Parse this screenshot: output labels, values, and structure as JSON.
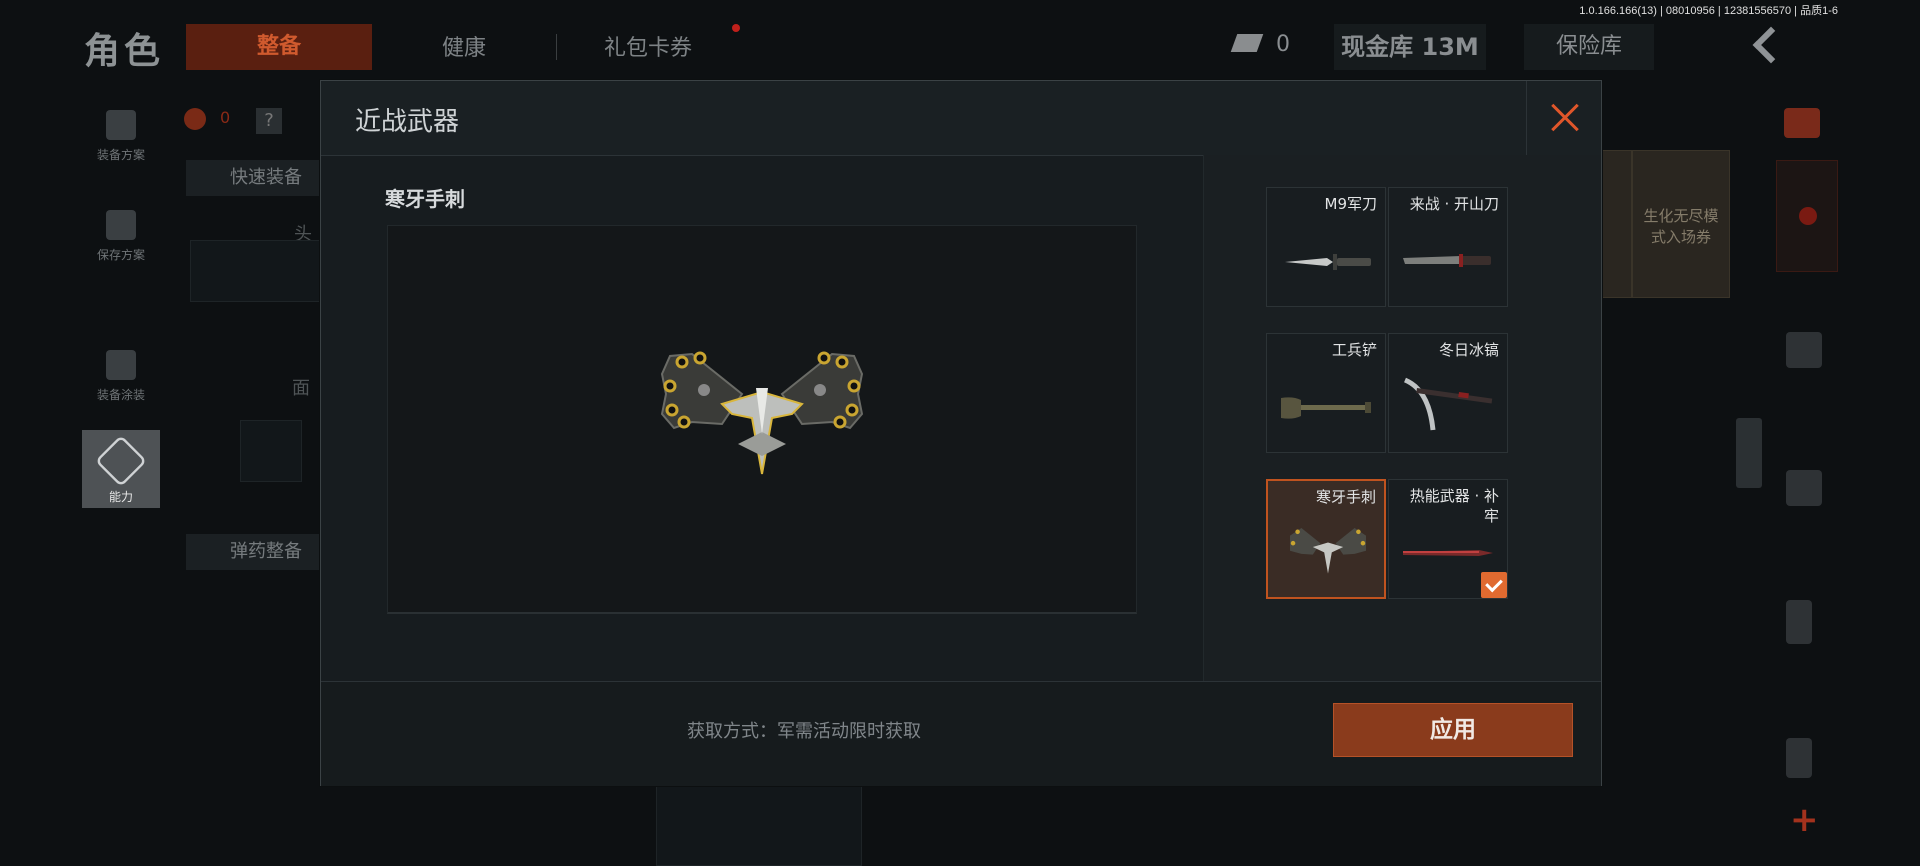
{
  "version_text": "1.0.166.166(13) | 08010956 | 12381556570 | 品质1-6",
  "background": {
    "title": "角色",
    "tabs": [
      "整备",
      "健康",
      "礼包卡券"
    ],
    "money_count": "0",
    "vault": "现金库 13M",
    "safe": "保险库",
    "side_buttons": [
      "装备方案",
      "保存方案",
      "装备涂装",
      "能力"
    ],
    "quick_equip": "快速装备",
    "ammo_equip": "弹药整备",
    "slot_head": "头",
    "slot_face": "面",
    "cards": [
      "生化无尽模式入场券"
    ],
    "red_count": "0"
  },
  "modal": {
    "title": "近战武器",
    "selected_item_name": "寒牙手刺",
    "source_text": "获取方式：军需活动限时获取",
    "apply_label": "应用",
    "items": [
      {
        "label": "M9军刀",
        "selected": false,
        "equipped": false,
        "icon": "knife-icon"
      },
      {
        "label": "来战 · 开山刀",
        "selected": false,
        "equipped": false,
        "icon": "machete-icon"
      },
      {
        "label": "工兵铲",
        "selected": false,
        "equipped": false,
        "icon": "shovel-icon"
      },
      {
        "label": "冬日冰镐",
        "selected": false,
        "equipped": false,
        "icon": "pickaxe-icon"
      },
      {
        "label": "寒牙手刺",
        "selected": true,
        "equipped": false,
        "icon": "claw-icon"
      },
      {
        "label": "热能武器 · 补牢",
        "selected": false,
        "equipped": true,
        "icon": "thermal-blade-icon"
      }
    ]
  },
  "colors": {
    "accent": "#e0562a",
    "apply_bg": "#8a3b1c",
    "selected_border": "#c0531f"
  }
}
